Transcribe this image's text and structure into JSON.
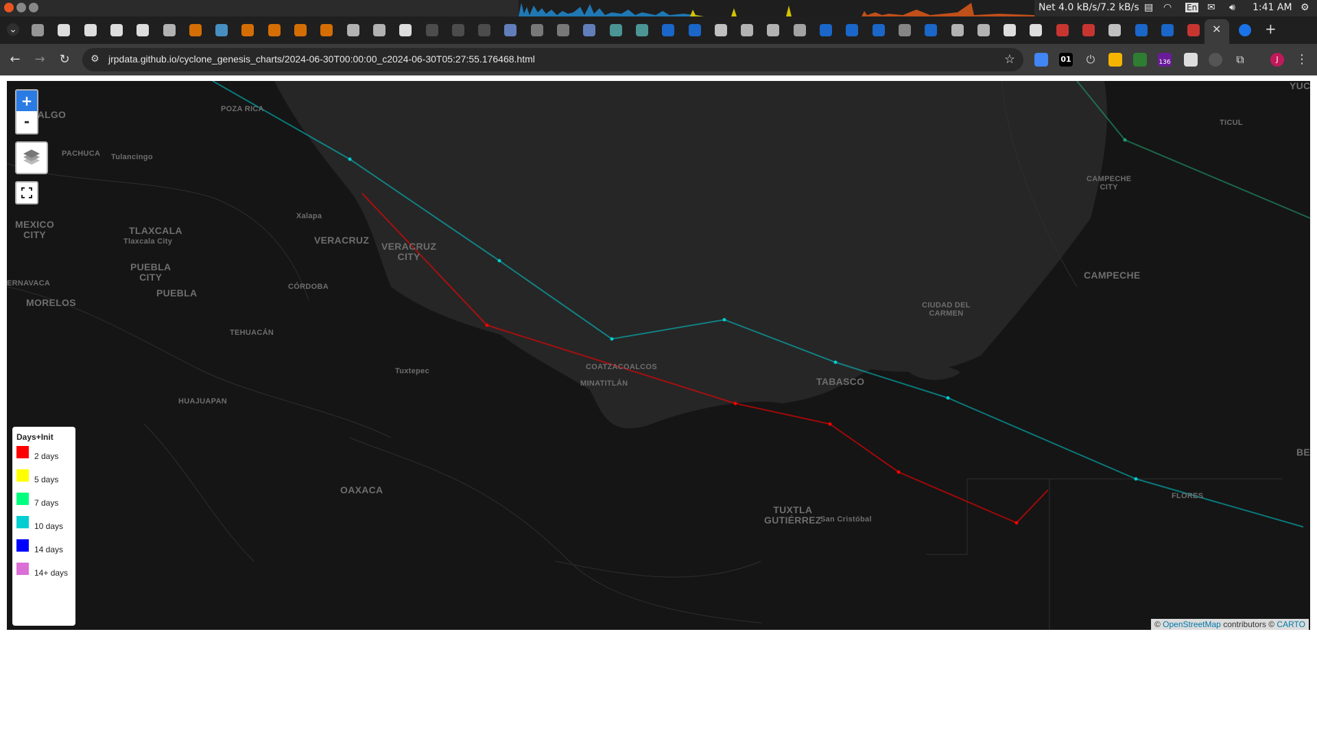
{
  "os_bar": {
    "net": "Net 4.0 kB/s/7.2 kB/s",
    "lang": "En",
    "clock": "1:41 AM"
  },
  "tabs": {
    "close_glyph": "✕",
    "new_tab_glyph": "+"
  },
  "navbar": {
    "url": "jrpdata.github.io/cyclone_genesis_charts/2024-06-30T00:00:00_c2024-06-30T05:27:55.176468.html",
    "ext_counter": "136",
    "ext_01": "01",
    "profile_initial": "J"
  },
  "map": {
    "zoom_in": "+",
    "zoom_out": "-",
    "places": [
      {
        "name": "HIDALGO",
        "text": "IDALGO",
        "cls": "big"
      },
      {
        "name": "poza-rica",
        "text": "POZA RICA",
        "cls": "small"
      },
      {
        "name": "pachuca",
        "text": "PACHUCA",
        "cls": "small"
      },
      {
        "name": "tulancingo",
        "text": "Tulancingo",
        "cls": "small"
      },
      {
        "name": "mexico-city",
        "text": "MEXICO\nCITY",
        "cls": "big"
      },
      {
        "name": "tlaxcala",
        "text": "TLAXCALA",
        "cls": "big"
      },
      {
        "name": "tlaxcala-city",
        "text": "Tlaxcala City",
        "cls": "small"
      },
      {
        "name": "xalapa",
        "text": "Xalapa",
        "cls": "small"
      },
      {
        "name": "veracruz",
        "text": "VERACRUZ",
        "cls": "big"
      },
      {
        "name": "veracruz-city",
        "text": "VERACRUZ\nCITY",
        "cls": "big"
      },
      {
        "name": "puebla-city",
        "text": "PUEBLA\nCITY",
        "cls": "big"
      },
      {
        "name": "puebla",
        "text": "PUEBLA",
        "cls": "big"
      },
      {
        "name": "cuernavaca",
        "text": "ERNAVACA",
        "cls": "small"
      },
      {
        "name": "morelos",
        "text": "MORELOS",
        "cls": "big"
      },
      {
        "name": "cordoba",
        "text": "CÓRDOBA",
        "cls": "small"
      },
      {
        "name": "tehuacan",
        "text": "TEHUACÁN",
        "cls": "small"
      },
      {
        "name": "huajuapan",
        "text": "HUAJUAPAN",
        "cls": "small"
      },
      {
        "name": "tuxtepec",
        "text": "Tuxtepec",
        "cls": "small"
      },
      {
        "name": "coatzacoalcos",
        "text": "COATZACOALCOS",
        "cls": "small"
      },
      {
        "name": "minatitlan",
        "text": "MINATITLÁN",
        "cls": "small"
      },
      {
        "name": "oaxaca",
        "text": "OAXACA",
        "cls": "big"
      },
      {
        "name": "tabasco",
        "text": "TABASCO",
        "cls": "big"
      },
      {
        "name": "ciudad-del-carmen",
        "text": "CIUDAD DEL\nCARMEN",
        "cls": "small"
      },
      {
        "name": "campeche",
        "text": "CAMPECHE",
        "cls": "big"
      },
      {
        "name": "campeche-city",
        "text": "CAMPECHE\nCITY",
        "cls": "small"
      },
      {
        "name": "ticul",
        "text": "TICUL",
        "cls": "small"
      },
      {
        "name": "yucatan",
        "text": "YUC",
        "cls": "big"
      },
      {
        "name": "tuxtla",
        "text": "TUXTLA\nGUTIÉRREZ",
        "cls": "big"
      },
      {
        "name": "san-cristobal",
        "text": "San Cristóbal",
        "cls": "small"
      },
      {
        "name": "flores",
        "text": "FLORES",
        "cls": "small"
      },
      {
        "name": "belize",
        "text": "BE",
        "cls": "big"
      }
    ],
    "legend": {
      "title": "Days+Init",
      "items": [
        {
          "label": "2 days",
          "color": "#ff0000"
        },
        {
          "label": "5 days",
          "color": "#ffff00"
        },
        {
          "label": "7 days",
          "color": "#00ff7f"
        },
        {
          "label": "10 days",
          "color": "#00ced1"
        },
        {
          "label": "14 days",
          "color": "#0000ff"
        },
        {
          "label": "14+ days",
          "color": "#da70d6"
        }
      ]
    },
    "attribution": {
      "prefix": "©",
      "osm": "OpenStreetMap",
      "mid": "contributors ©",
      "carto": "CARTO"
    }
  }
}
